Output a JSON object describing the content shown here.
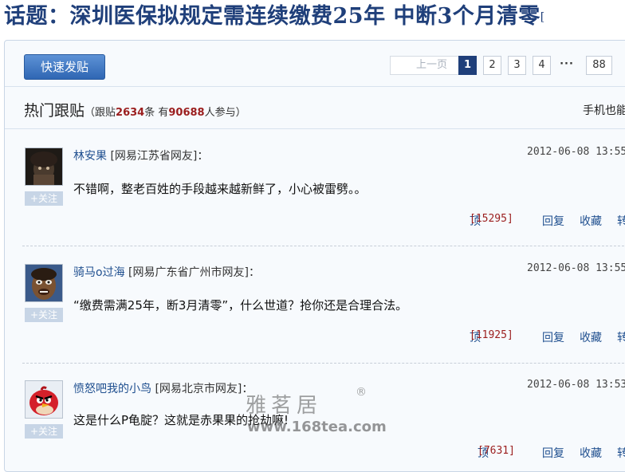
{
  "topic": {
    "title": "话题：深圳医保拟规定需连续缴费25年 中断3个月清零",
    "trail": "["
  },
  "toolbar": {
    "quick_post": "快速发贴"
  },
  "pager": {
    "prev": "上一页",
    "pages": [
      "1",
      "2",
      "3",
      "4"
    ],
    "ellipsis": "···",
    "last": "88",
    "current": "1"
  },
  "hot": {
    "heading": "热门跟贴",
    "stat_prefix": "（跟贴",
    "replies": "2634",
    "stat_mid": "条 有",
    "participants": "90688",
    "stat_suffix": "人参与）",
    "mobile": "手机也能"
  },
  "posts": [
    {
      "name": "林安果",
      "location": "[网易江苏省网友]：",
      "time": "2012-06-08 13:55",
      "content": "不错啊，整老百姓的手段越来越新鲜了，小心被雷劈。。",
      "up_label": "顶",
      "up_count": "[15295]",
      "reply": "回复",
      "fav": "收藏",
      "share": "转",
      "follow": "+关注"
    },
    {
      "name": "骑马o过海",
      "location": "[网易广东省广州市网友]：",
      "time": "2012-06-08 13:55",
      "content": "“缴费需满25年，断3月清零”，什么世道？抢你还是合理合法。",
      "up_label": "顶",
      "up_count": "[11925]",
      "reply": "回复",
      "fav": "收藏",
      "share": "转",
      "follow": "+关注"
    },
    {
      "name": "愤怒吧我的小鸟",
      "location": "[网易北京市网友]：",
      "time": "2012-06-08 13:53",
      "content": "这是什么P龟腚？这就是赤果果的抢劫嘛!",
      "up_label": "顶",
      "up_count": "[7631]",
      "reply": "回复",
      "fav": "收藏",
      "share": "转",
      "follow": "+关注"
    }
  ],
  "watermark": {
    "cn": "雅茗居",
    "reg": "®",
    "url": "www.168tea.com"
  }
}
